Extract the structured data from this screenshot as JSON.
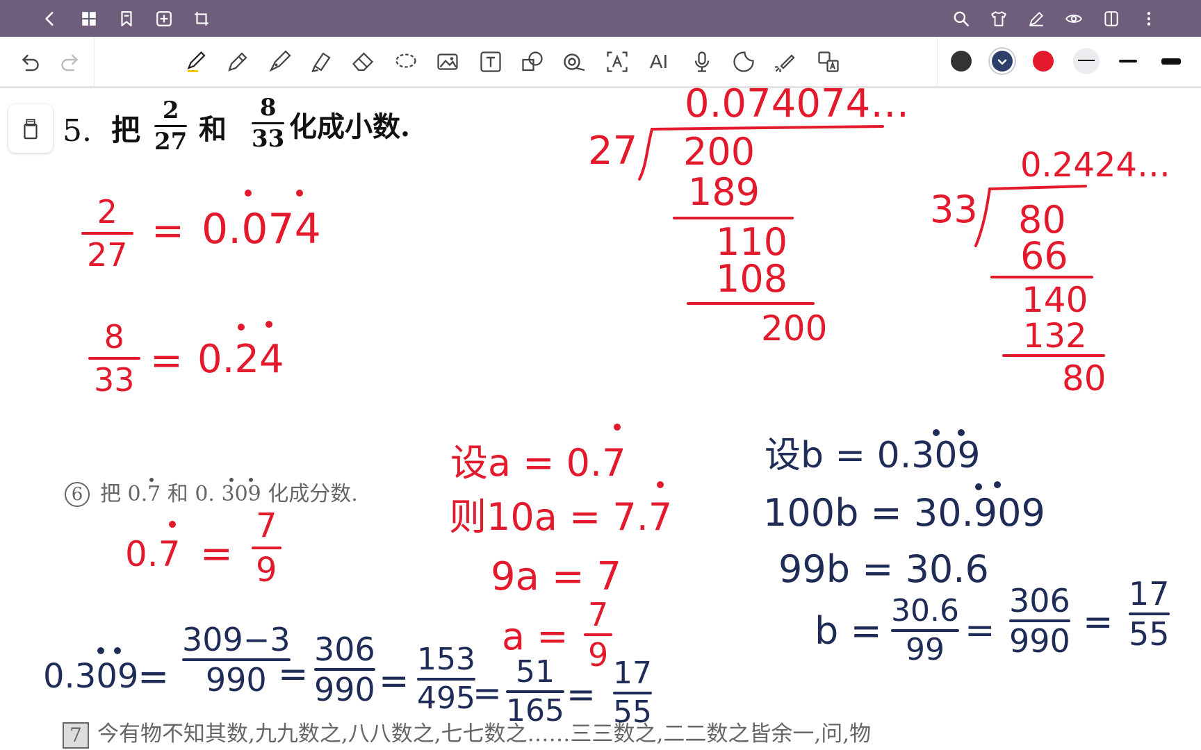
{
  "colors": {
    "topbar": "#6f5d7c",
    "ink_red": "#e3192c",
    "ink_blue": "#1f2c57",
    "swatch_black": "#333333",
    "swatch_navy": "#2b3f6a",
    "swatch_red": "#e3192c"
  },
  "topbar": {
    "left_icons": [
      "back-icon",
      "grid-icon",
      "bookmark-icon",
      "add-page-icon",
      "crop-icon"
    ],
    "right_icons": [
      "search-icon",
      "shirt-icon",
      "pen-edit-icon",
      "eye-icon",
      "split-view-icon",
      "more-icon"
    ]
  },
  "toolbar": {
    "ai_label": "AI",
    "tools": [
      "pen",
      "pencil",
      "fountain-pen",
      "highlighter",
      "eraser",
      "lasso",
      "image",
      "text-box",
      "shape",
      "tape",
      "text-recognition",
      "ai",
      "microphone",
      "sticker",
      "laser-pointer",
      "translate"
    ],
    "colors": [
      "black",
      "navy",
      "red"
    ],
    "selected_color": "navy"
  },
  "content": {
    "q5": {
      "number": "5.",
      "p1": "把",
      "f1n": "2",
      "f1d": "27",
      "and": "和",
      "f2n": "8",
      "f2d": "33",
      "p2": "化成小数."
    },
    "ans1": {
      "num": "2",
      "den": "27",
      "eq": "=",
      "value": "0.074"
    },
    "ans2": {
      "num": "8",
      "den": "33",
      "eq": "=",
      "value": "0.24"
    },
    "div1": {
      "quotient": "0.074074…",
      "divisor": "27",
      "rows": [
        "200",
        "189",
        "110",
        "108",
        "200"
      ]
    },
    "div2": {
      "quotient": "0.2424…",
      "divisor": "33",
      "rows": [
        "80",
        "66",
        "140",
        "132",
        "80"
      ]
    },
    "q6": {
      "number": "6",
      "text": "把 0.7 和 0. 309 化成分数."
    },
    "ans6a": {
      "lhs": "0.7",
      "eq": "=",
      "num": "7",
      "den": "9"
    },
    "ans6b": {
      "lhs": "0.309",
      "eq": "=",
      "steps": [
        {
          "num": "309−3",
          "den": "990"
        },
        {
          "num": "306",
          "den": "990"
        },
        {
          "num": "153",
          "den": "495"
        },
        {
          "num": "51",
          "den": "165"
        },
        {
          "num": "17",
          "den": "55"
        }
      ]
    },
    "sol_a": {
      "l1": "设a = 0.7",
      "l2": "则10a = 7.7",
      "l3": "9a = 7",
      "l4_lhs": "a =",
      "l4_num": "7",
      "l4_den": "9"
    },
    "sol_b": {
      "l1": "设b = 0.309",
      "l2": "100b = 30.909",
      "l3": "99b = 30.6",
      "l4_lhs": "b =",
      "f1n": "30.6",
      "f1d": "99",
      "f2n": "306",
      "f2d": "990",
      "f3n": "17",
      "f3d": "55"
    },
    "q7": {
      "number": "7",
      "text": "今有物不知其数,九九数之,八八数之,七七数之……三三数之,二二数之皆余一,问,物"
    }
  }
}
